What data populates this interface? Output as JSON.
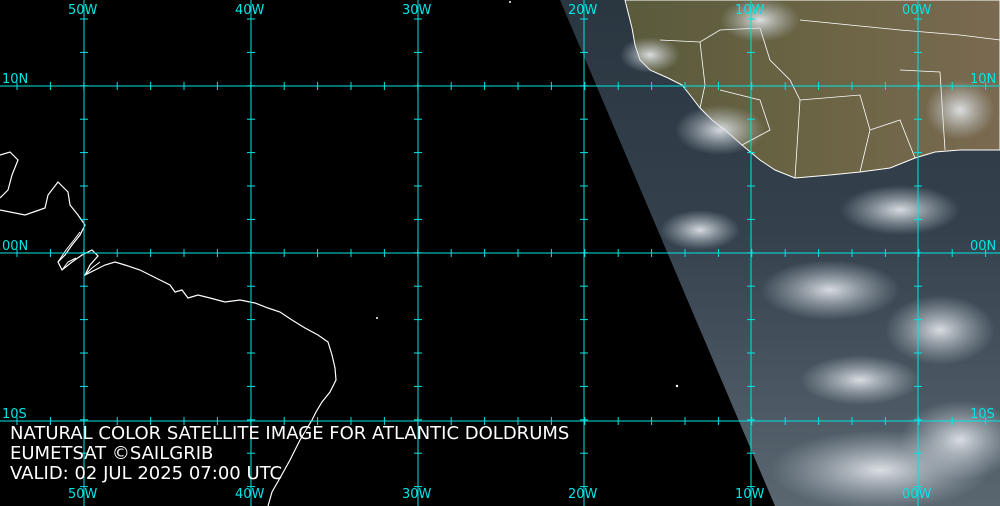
{
  "map": {
    "longitude_labels": [
      "50W",
      "40W",
      "30W",
      "20W",
      "10W",
      "00W"
    ],
    "latitude_labels": [
      "10N",
      "00N",
      "10S"
    ],
    "grid_color": "#00e5e5",
    "land_outline_color": "#ffffff"
  },
  "caption": {
    "line1": "NATURAL COLOR SATELLITE IMAGE FOR ATLANTIC DOLDRUMS",
    "line2": "EUMETSAT ©SAILGRIB",
    "line3": "VALID:  02 JUL 2025 07:00 UTC"
  }
}
